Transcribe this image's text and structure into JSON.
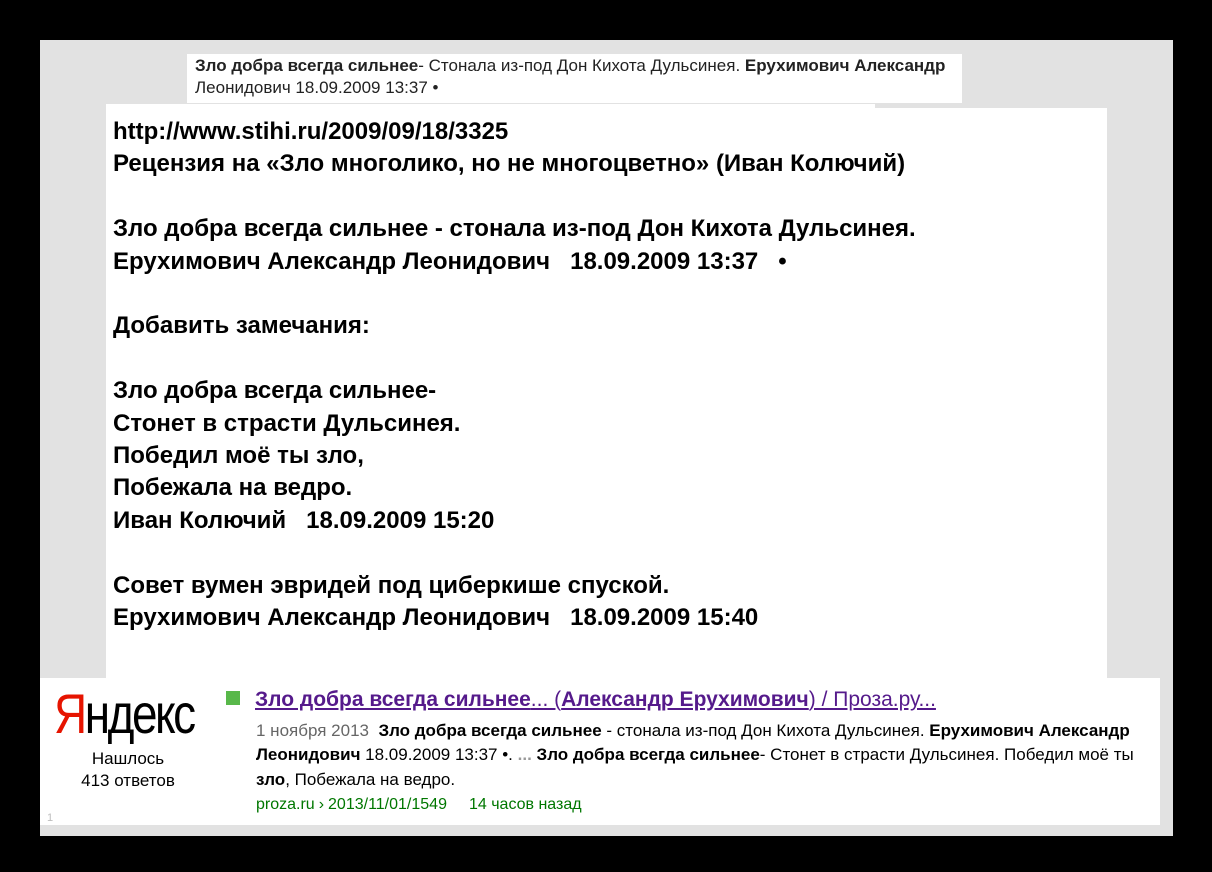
{
  "top_snippet": {
    "part1_bold": "Зло добра всегда сильнее",
    "part2": "- Стонала из-под Дон Кихота Дульсинея. ",
    "part3_bold": "Ерухимович Александр",
    "part4": " Леонидович 18.09.2009 13:37 •"
  },
  "main": {
    "lines": [
      "http://www.stihi.ru/2009/09/18/3325",
      "Рецензия на «Зло многолико, но не многоцветно» (Иван Колючий)",
      "",
      "Зло добра всегда сильнее - стонала из-под Дон Кихота Дульсинея.",
      "Ерухимович Александр Леонидович   18.09.2009 13:37   •",
      "",
      "Добавить замечания:",
      "",
      "Зло добра всегда сильнее-",
      "Стонет в страсти Дульсинея.",
      "Победил моё ты зло,",
      "Побежала на ведро.",
      "Иван Колючий   18.09.2009 15:20",
      "",
      "Совет вумен эвридей под циберкише спуской.",
      "Ерухимович Александр Леонидович   18.09.2009 15:40"
    ]
  },
  "yandex": {
    "logo_first": "Я",
    "logo_rest": "ндекс",
    "found_line1": "Нашлось",
    "found_line2": "413 ответов",
    "page_number": "1",
    "result": {
      "title_part1": "Зло добра всегда сильнее",
      "title_part2": "... (",
      "title_part3": "Александр Ерухимович",
      "title_part4": ") / Проза.ру...",
      "date": "1 ноября 2013",
      "s1": "Зло добра всегда сильнее",
      "s2": " - стонала из-под Дон Кихота Дульсинея. ",
      "s3": "Ерухимович Александр Леонидович",
      "s4": " 18.09.2009 13:37 •. ",
      "s5": "...",
      "s6": " ",
      "s7": "Зло добра всегда сильнее",
      "s8": "- Стонет в страсти Дульсинея. Победил моё ты ",
      "s9": "зло",
      "s10": ", Побежала на ведро.",
      "url_domain": "proza.ru",
      "url_sep": "›",
      "url_path": "2013/11/01/1549",
      "time_ago": "14 часов назад"
    },
    "colors": {
      "logo_red": "#e61400",
      "title_link": "#551a8b",
      "url_green": "#007700",
      "marker_green": "#58b84a"
    }
  }
}
